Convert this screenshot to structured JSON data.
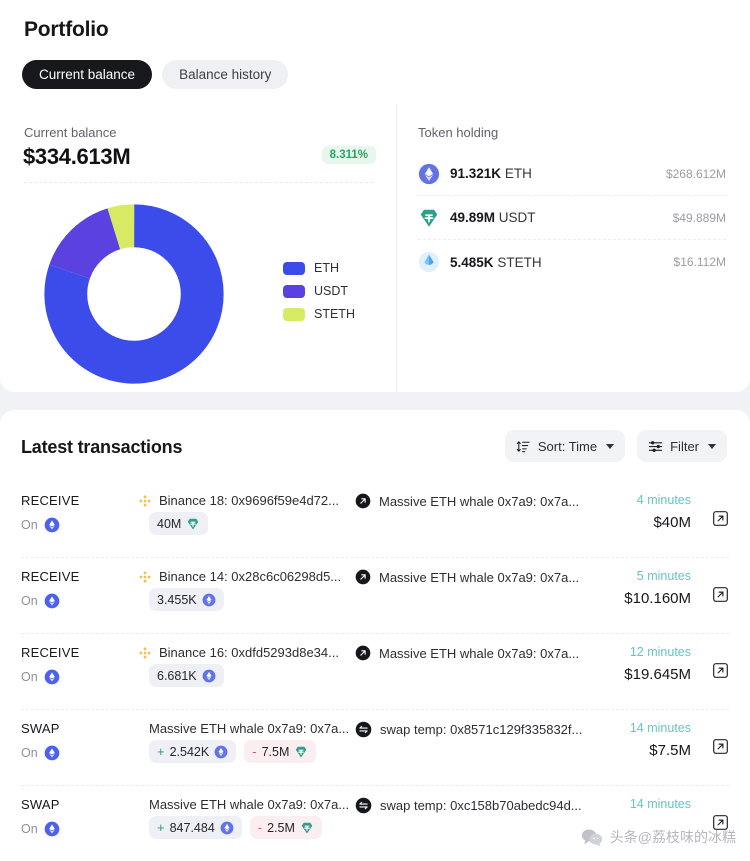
{
  "portfolio": {
    "title": "Portfolio",
    "tabs": [
      {
        "label": "Current balance",
        "active": true
      },
      {
        "label": "Balance history",
        "active": false
      }
    ],
    "balance": {
      "label": "Current balance",
      "value": "$334.613M",
      "change": "8.311%",
      "change_color": "#2aa563"
    },
    "token_holding": {
      "label": "Token holding",
      "rows": [
        {
          "amount": "91.321K",
          "symbol": "ETH",
          "usd": "$268.612M",
          "icon": "eth-icon"
        },
        {
          "amount": "49.89M",
          "symbol": "USDT",
          "usd": "$49.889M",
          "icon": "usdt-icon"
        },
        {
          "amount": "5.485K",
          "symbol": "STETH",
          "usd": "$16.112M",
          "icon": "steth-icon"
        }
      ]
    }
  },
  "chart_data": {
    "type": "pie",
    "title": "Current balance",
    "categories": [
      "ETH",
      "USDT",
      "STETH"
    ],
    "values": [
      268.612,
      49.889,
      16.112
    ],
    "percents": [
      80.3,
      14.9,
      4.8
    ],
    "colors": [
      "#3b4ceb",
      "#5b42e0",
      "#d8ea64"
    ],
    "legend_position": "right",
    "donut": true,
    "unit": "USD (millions)"
  },
  "transactions": {
    "title": "Latest transactions",
    "sort": {
      "label": "Sort: Time",
      "icon": "sort-icon"
    },
    "filter": {
      "label": "Filter",
      "icon": "filter-icon"
    },
    "rows": [
      {
        "kind": "RECEIVE",
        "on_label": "On",
        "chain_icon": "eth-chain-icon",
        "from": "Binance 18: 0x9696f59e4d72...",
        "from_icon": "binance-icon",
        "to": "Massive ETH whale 0x7a9: 0x7a...",
        "to_icon": "whale-arrow-icon",
        "badges": [
          {
            "sign": "",
            "amount": "40M",
            "token": "usdt-icon",
            "negative": false
          }
        ],
        "time": "4 minutes",
        "usd": "$40M"
      },
      {
        "kind": "RECEIVE",
        "on_label": "On",
        "chain_icon": "eth-chain-icon",
        "from": "Binance 14: 0x28c6c06298d5...",
        "from_icon": "binance-icon",
        "to": "Massive ETH whale 0x7a9: 0x7a...",
        "to_icon": "whale-arrow-icon",
        "badges": [
          {
            "sign": "",
            "amount": "3.455K",
            "token": "eth-icon",
            "negative": false
          }
        ],
        "time": "5 minutes",
        "usd": "$10.160M"
      },
      {
        "kind": "RECEIVE",
        "on_label": "On",
        "chain_icon": "eth-chain-icon",
        "from": "Binance 16: 0xdfd5293d8e34...",
        "from_icon": "binance-icon",
        "to": "Massive ETH whale 0x7a9: 0x7a...",
        "to_icon": "whale-arrow-icon",
        "badges": [
          {
            "sign": "",
            "amount": "6.681K",
            "token": "eth-icon",
            "negative": false
          }
        ],
        "time": "12 minutes",
        "usd": "$19.645M"
      },
      {
        "kind": "SWAP",
        "on_label": "On",
        "chain_icon": "eth-chain-icon",
        "from": "Massive ETH whale 0x7a9: 0x7a...",
        "from_icon": "",
        "to": "swap temp: 0x8571c129f335832f...",
        "to_icon": "swap-icon",
        "badges": [
          {
            "sign": "+",
            "amount": "2.542K",
            "token": "eth-icon",
            "negative": false
          },
          {
            "sign": "-",
            "amount": "7.5M",
            "token": "usdt-icon",
            "negative": true
          }
        ],
        "time": "14 minutes",
        "usd": "$7.5M"
      },
      {
        "kind": "SWAP",
        "on_label": "On",
        "chain_icon": "eth-chain-icon",
        "from": "Massive ETH whale 0x7a9: 0x7a...",
        "from_icon": "",
        "to": "swap temp: 0xc158b70abedc94d...",
        "to_icon": "swap-icon",
        "badges": [
          {
            "sign": "+",
            "amount": "847.484",
            "token": "eth-icon",
            "negative": false
          },
          {
            "sign": "-",
            "amount": "2.5M",
            "token": "usdt-icon",
            "negative": true
          }
        ],
        "time": "14 minutes",
        "usd": ""
      }
    ]
  },
  "watermark": {
    "text": "头条@荔枝味的冰糕",
    "icon": "wechat-icon"
  }
}
